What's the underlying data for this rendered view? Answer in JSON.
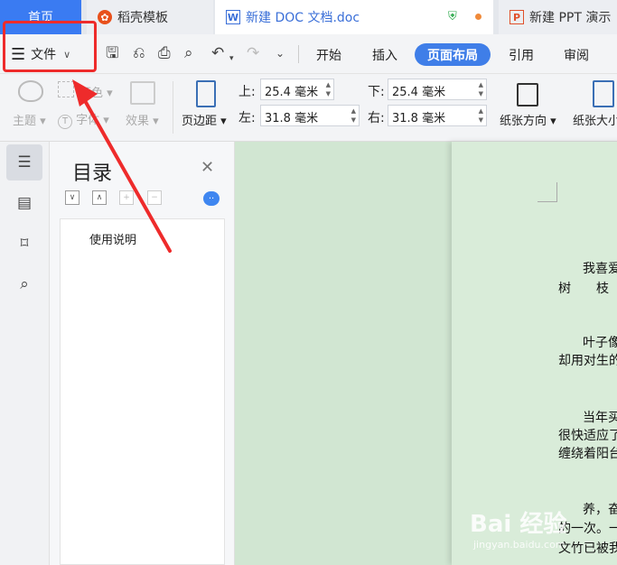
{
  "tabs": {
    "home": "首页",
    "daoke": "稻壳模板",
    "doc": "新建 DOC 文档.doc",
    "ppt": "新建 PPT 演示"
  },
  "toolbar": {
    "file_menu": "文件",
    "ribbon_tabs": [
      "开始",
      "插入",
      "页面布局",
      "引用",
      "审阅"
    ],
    "active_tab": "页面布局"
  },
  "ribbon": {
    "theme": "主题",
    "color": "颜色",
    "font": "字体",
    "effect": "效果",
    "margins_button": "页边距",
    "margin_top_label": "上:",
    "margin_top": "25.4 毫米",
    "margin_bottom_label": "下:",
    "margin_bottom": "25.4 毫米",
    "margin_left_label": "左:",
    "margin_left": "31.8 毫米",
    "margin_right_label": "右:",
    "margin_right": "31.8 毫米",
    "orientation": "纸张方向",
    "paper_size": "纸张大小"
  },
  "toc": {
    "title": "目录",
    "item": "使用说明"
  },
  "document": {
    "p1a": "我喜爱",
    "p1b": "树　　枝",
    "p2a": "叶子像",
    "p2b": "却用对生的",
    "p3a": "当年买",
    "p3b": "很快适应了",
    "p3c": "缠绕着阳台",
    "p4a": "养，奋",
    "p4b": "的一次。一",
    "p4c": "文竹已被我"
  },
  "watermark": {
    "brand": "Bai 经验",
    "url": "jingyan.baidu.com"
  },
  "colors": {
    "accent": "#3f7ee8",
    "annotation": "#ee2b2b",
    "canvas": "#d1e6d2"
  }
}
